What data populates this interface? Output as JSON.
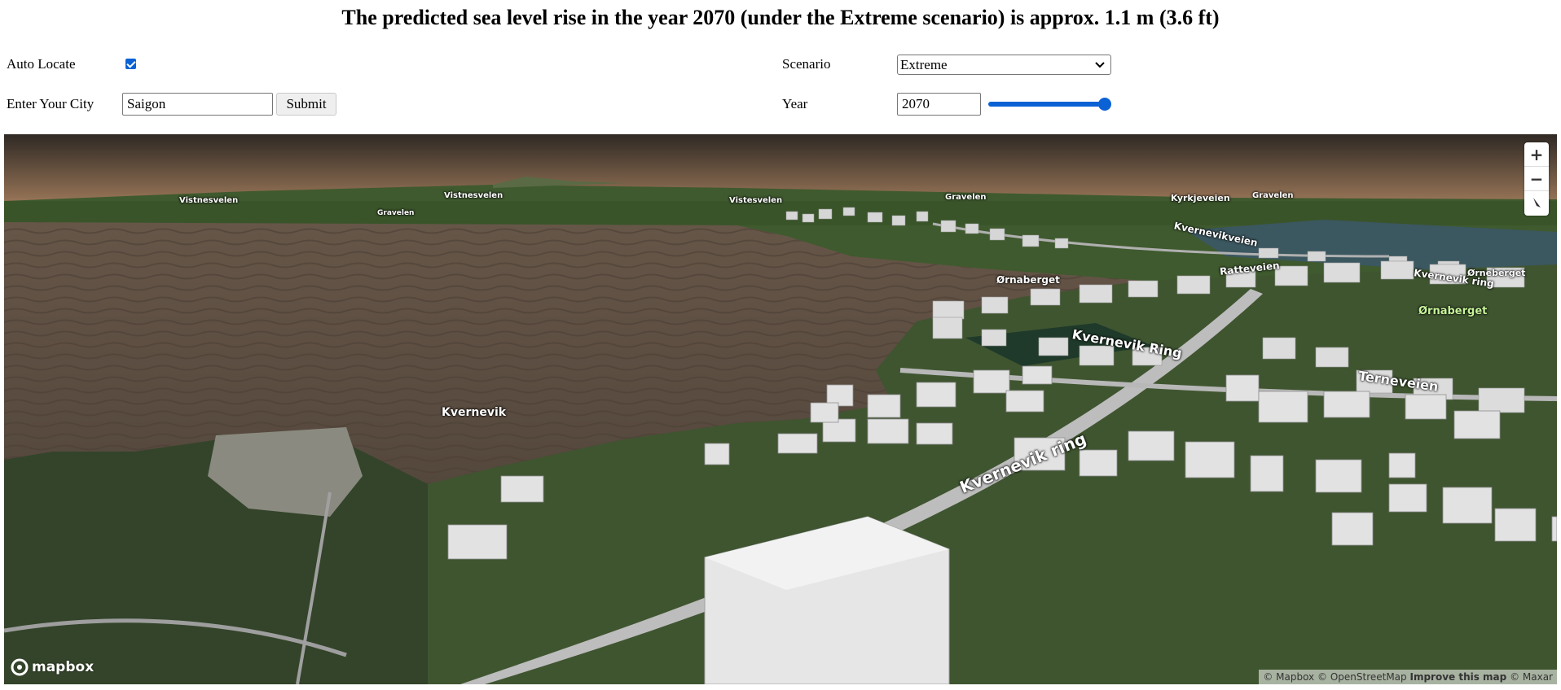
{
  "title": "The predicted sea level rise in the year 2070 (under the Extreme scenario) is approx. 1.1 m (3.6 ft)",
  "controls": {
    "auto_locate_label": "Auto Locate",
    "auto_locate_checked": true,
    "city_label": "Enter Your City",
    "city_value": "Saigon",
    "submit_label": "Submit",
    "scenario_label": "Scenario",
    "scenario_selected": "Extreme",
    "year_label": "Year",
    "year_value": "2070",
    "year_slider_fraction": 1.0
  },
  "map": {
    "labels": {
      "vistnesvelen_1": "Vistnesvelen",
      "vistnesvelen_2": "Vistnesvelen",
      "vistnesvelen_3": "Vistesvelen",
      "gravelen_1": "Gravelen",
      "gravelen_2": "Gravelen",
      "gravelen_3": "Gravelen",
      "kyrkjeveien": "Kyrkjeveien",
      "kvernevikveien": "Kvernevikveien",
      "ornaberget_1": "Ørnaberget",
      "ornaberget_2": "Ørnaberget",
      "kvernevik": "Kvernevik",
      "kvernevik_ring_1": "Kvernevik Ring",
      "kvernevik_ring_2": "Kvernevik ring",
      "kvernevik_ring_3": "Kvernevik ring",
      "terneveien": "Terneveien",
      "ratteveien": "Ratteveien",
      "orneberget_small": "Ørneberget"
    },
    "zoom_in": "+",
    "zoom_out": "−",
    "logo_text": "mapbox",
    "attribution": {
      "mapbox": "© Mapbox",
      "osm": "© OpenStreetMap",
      "improve": "Improve this map",
      "maxar": "© Maxar"
    },
    "colors": {
      "sky_top": "#3a2e27",
      "sky_bottom": "#a17c5c",
      "flood": "#5f5044",
      "land_dark": "#2e3e22",
      "land": "#4b6336",
      "road": "#c9c9c9",
      "building": "#d9d9d9"
    }
  }
}
